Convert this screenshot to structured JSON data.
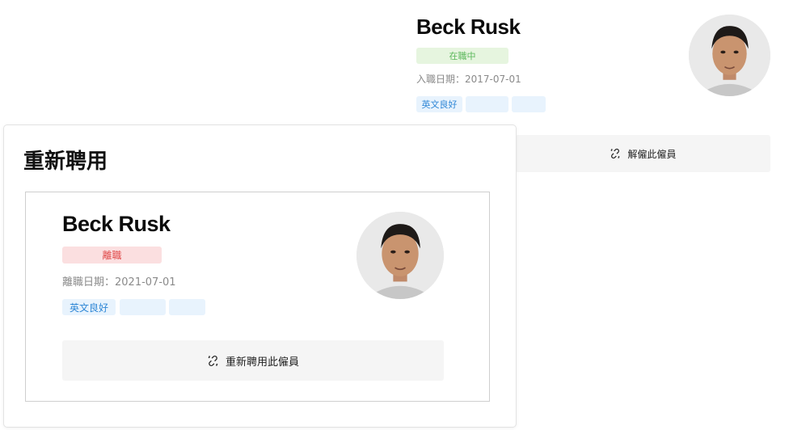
{
  "background_card": {
    "name": "Beck Rusk",
    "status": "在職中",
    "date": "入職日期：2017-07-01",
    "tags": [
      "英文良好",
      "",
      ""
    ],
    "action_label": "解僱此僱員",
    "action_icon": "unlink-icon",
    "status_color": "#5cb85c",
    "status_bg": "#e6f5df"
  },
  "modal": {
    "title": "重新聘用",
    "card": {
      "name": "Beck Rusk",
      "status": "離職",
      "date": "離職日期：2021-07-01",
      "tags": [
        "英文良好",
        "",
        ""
      ],
      "action_label": "重新聘用此僱員",
      "action_icon": "unlink-icon",
      "status_color": "#e04848",
      "status_bg": "#fbdfe0"
    }
  },
  "colors": {
    "tag_bg": "#e8f3fd",
    "tag_text": "#2f87d6",
    "action_bg": "#f5f5f5"
  }
}
